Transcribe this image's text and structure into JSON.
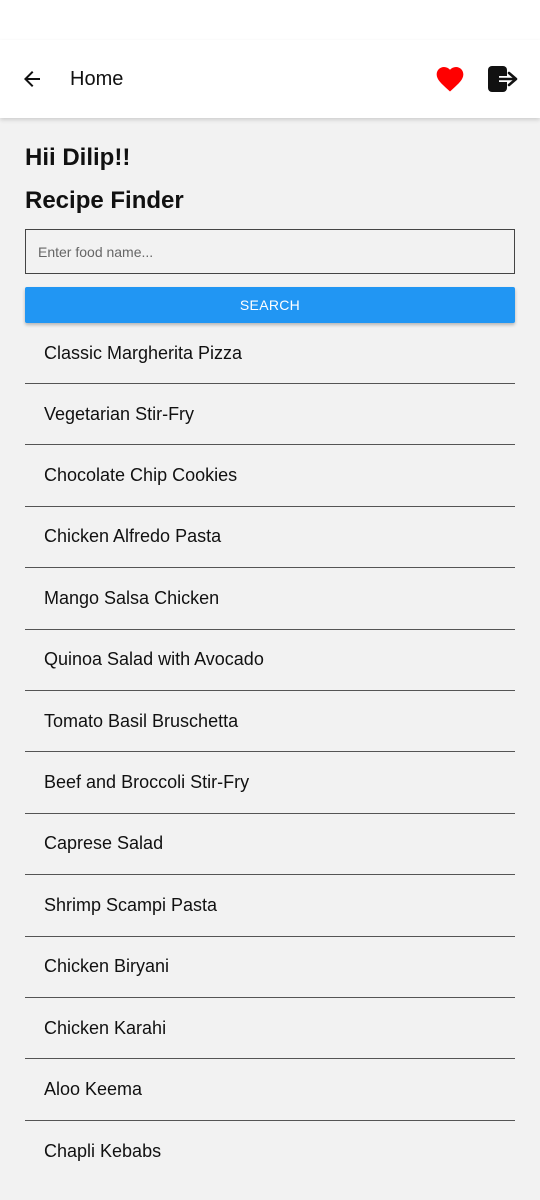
{
  "app_bar": {
    "title": "Home",
    "icons": {
      "back": "arrow-left-icon",
      "favorites": "heart-icon",
      "logout": "logout-icon"
    },
    "favorite_color": "#ff0000"
  },
  "main": {
    "greeting": "Hii Dilip!!",
    "title": "Recipe Finder",
    "search": {
      "placeholder": "Enter food name...",
      "value": "",
      "button_label": "SEARCH"
    },
    "accent_color": "#2196f3",
    "recipes": [
      "Classic Margherita Pizza",
      "Vegetarian Stir-Fry",
      "Chocolate Chip Cookies",
      "Chicken Alfredo Pasta",
      "Mango Salsa Chicken",
      "Quinoa Salad with Avocado",
      "Tomato Basil Bruschetta",
      "Beef and Broccoli Stir-Fry",
      "Caprese Salad",
      "Shrimp Scampi Pasta",
      "Chicken Biryani",
      "Chicken Karahi",
      "Aloo Keema",
      "Chapli Kebabs"
    ]
  }
}
